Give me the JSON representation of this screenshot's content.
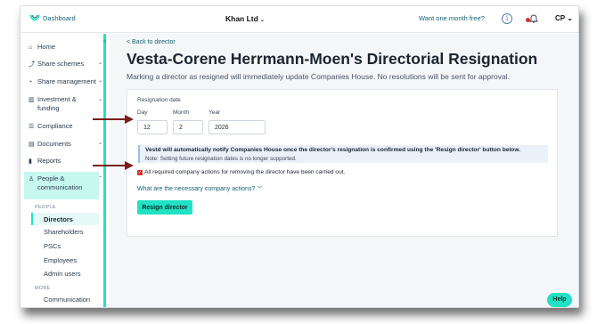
{
  "topbar": {
    "dashboard_label": "Dashboard",
    "company_name": "Khan Ltd",
    "promo_link": "Want one month free?",
    "user_initials": "CP"
  },
  "sidebar": {
    "items": [
      {
        "label": "Home",
        "icon": "home-icon"
      },
      {
        "label": "Share schemes",
        "icon": "share-schemes-icon"
      },
      {
        "label": "Share management",
        "icon": "share-management-icon"
      },
      {
        "label": "Investment & funding",
        "icon": "investment-icon"
      },
      {
        "label": "Compliance",
        "icon": "compliance-icon"
      },
      {
        "label": "Documents",
        "icon": "documents-icon"
      },
      {
        "label": "Reports",
        "icon": "reports-icon"
      },
      {
        "label": "People & communication",
        "icon": "people-icon"
      }
    ],
    "people_heading": "PEOPLE",
    "people_items": [
      "Directors",
      "Shareholders",
      "PSCs",
      "Employees",
      "Admin users"
    ],
    "more_heading": "MORE",
    "more_items": [
      "Communication"
    ]
  },
  "page": {
    "back_link": "< Back to director",
    "title": "Vesta-Corene Herrmann-Moen's Directorial Resignation",
    "subtitle": "Marking a director as resigned will immediately update Companies House. No resolutions will be sent for approval."
  },
  "form": {
    "section_label": "Resignation date",
    "day_label": "Day",
    "month_label": "Month",
    "year_label": "Year",
    "day_value": "12",
    "month_value": "2",
    "year_value": "2026",
    "notice_text": "Vestd will automatically notify Companies House once the director's resignation is confirmed using the 'Resign director' button below.",
    "note_text": "Note: Setting future resignation dates is no longer supported.",
    "checkbox_label": "All required company actions for removing the director have been carried out.",
    "checkbox_checked": true,
    "actions_link": "What are the necessary company actions?",
    "submit_label": "Resign director"
  },
  "help_label": "Help",
  "colors": {
    "accent": "#21e2c3",
    "link": "#14626f",
    "checkbox": "#d9302c",
    "arrow": "#7a1d1d"
  }
}
